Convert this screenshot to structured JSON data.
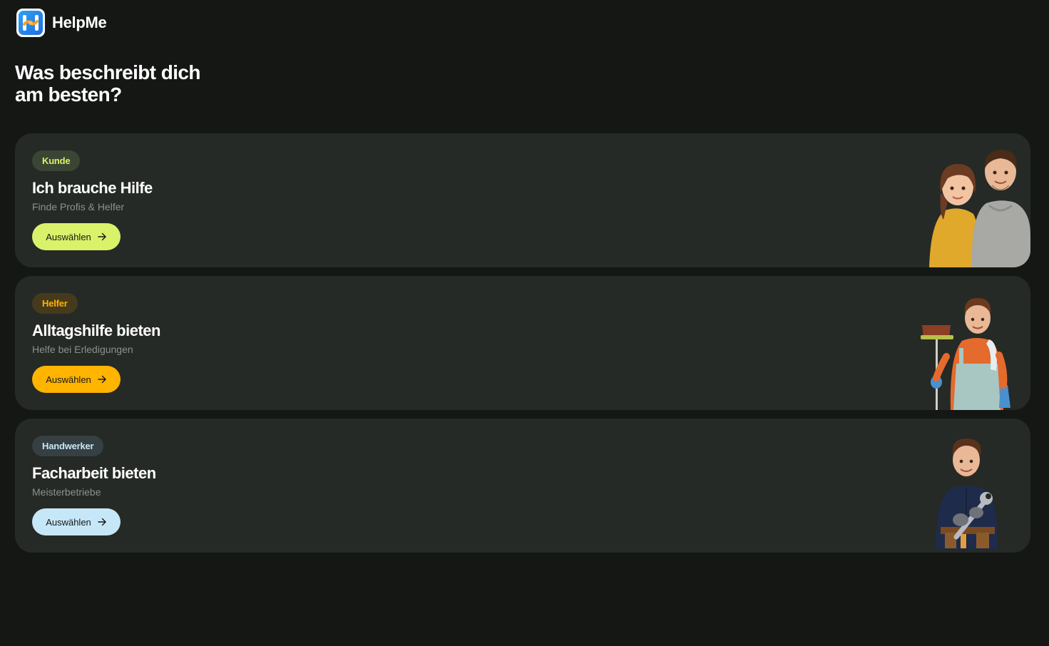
{
  "app": {
    "name": "HelpMe"
  },
  "page": {
    "heading": "Was beschreibt dich am besten?"
  },
  "cards": [
    {
      "badge": "Kunde",
      "title": "Ich brauche Hilfe",
      "subtitle": "Finde Profis & Helfer",
      "button_label": "Auswählen",
      "accent": "#d9f26a",
      "badge_bg": "#3b4534",
      "badge_color": "#d9f26a",
      "illustration": "couple-illustration"
    },
    {
      "badge": "Helfer",
      "title": "Alltagshilfe bieten",
      "subtitle": "Helfe bei Erledigungen",
      "button_label": "Auswählen",
      "accent": "#ffb400",
      "badge_bg": "#463a1c",
      "badge_color": "#ffb400",
      "illustration": "cleaner-illustration"
    },
    {
      "badge": "Handwerker",
      "title": "Facharbeit bieten",
      "subtitle": "Meisterbetriebe",
      "button_label": "Auswählen",
      "accent": "#c6e7f8",
      "badge_bg": "#363f41",
      "badge_color": "#c6e7f8",
      "illustration": "craftsman-illustration"
    }
  ]
}
